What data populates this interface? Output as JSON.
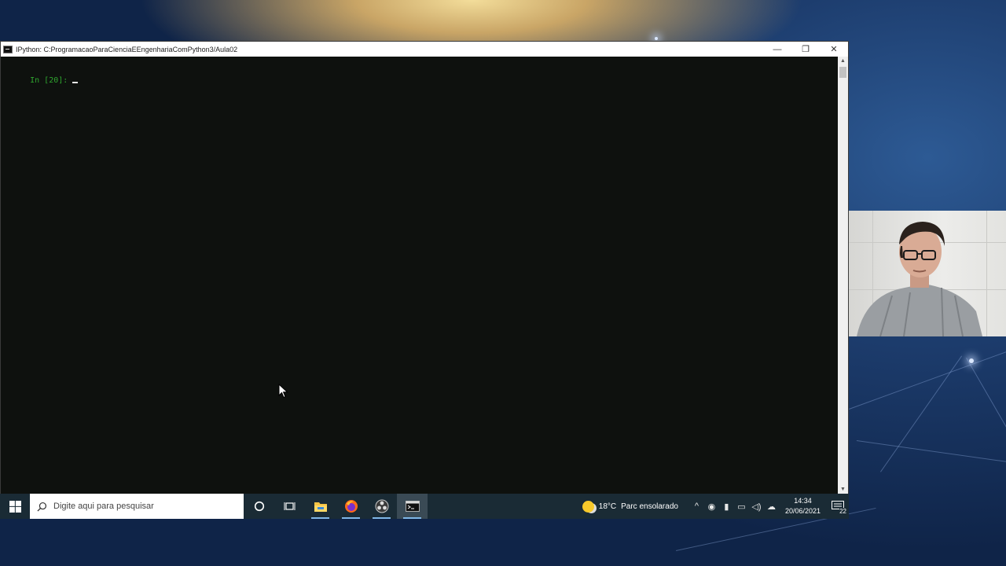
{
  "window": {
    "title": "IPython: C:ProgramacaoParaCienciaEEngenhariaComPython3/Aula02",
    "controls": {
      "minimize": "—",
      "restore": "❐",
      "close": "✕"
    }
  },
  "console": {
    "prompt": "In [20]:"
  },
  "taskbar": {
    "search_placeholder": "Digite aqui para pesquisar",
    "apps": [
      "cortana-icon",
      "task-view-icon",
      "file-explorer-icon",
      "firefox-icon",
      "obs-icon",
      "terminal-icon"
    ],
    "weather": {
      "temperature": "18°C",
      "condition": "Parc ensolarado"
    },
    "clock": {
      "time": "14:34",
      "date": "20/06/2021"
    },
    "notification_count": "22"
  },
  "colors": {
    "console_bg": "#0e110e",
    "prompt_green": "#2fa52f",
    "taskbar_bg": "#1a2b35",
    "wallpaper_blue": "#173463"
  }
}
